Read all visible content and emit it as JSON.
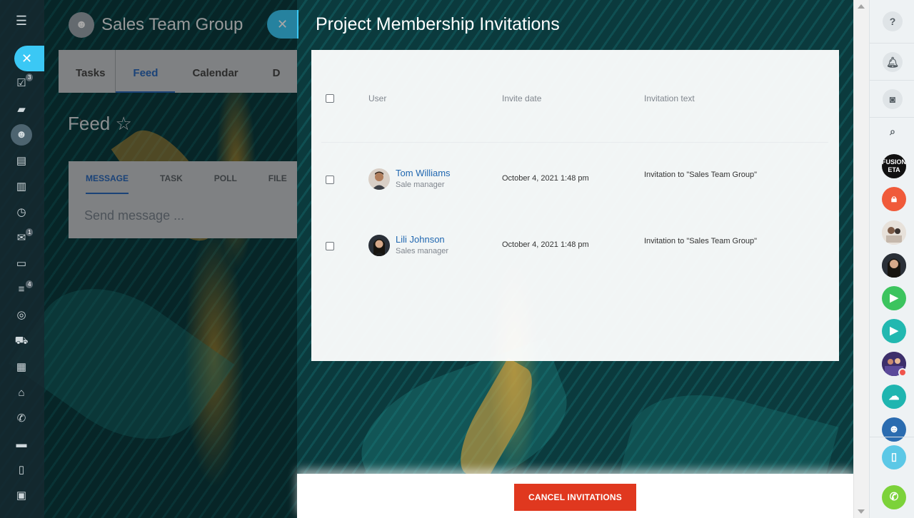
{
  "left_rail": {
    "badges": {
      "tasks": "3",
      "mail": "1",
      "crm": "4"
    }
  },
  "underlying": {
    "group_title": "Sales Team Group",
    "tabs": [
      "Tasks",
      "Feed",
      "Calendar",
      "D"
    ],
    "active_tab": "Feed",
    "feed_title": "Feed",
    "composer_tabs": [
      "MESSAGE",
      "TASK",
      "POLL",
      "FILE"
    ],
    "composer_placeholder": "Send message ..."
  },
  "panel": {
    "title": "Project Membership Invitations",
    "columns": {
      "user": "User",
      "date": "Invite date",
      "text": "Invitation text"
    },
    "rows": [
      {
        "name": "Tom Williams",
        "position": "Sale manager",
        "date": "October 4, 2021 1:48 pm",
        "text": "Invitation to \"Sales Team Group\""
      },
      {
        "name": "Lili Johnson",
        "position": "Sales manager",
        "date": "October 4, 2021 1:48 pm",
        "text": "Invitation to \"Sales Team Group\""
      }
    ],
    "cancel_label": "CANCEL INVITATIONS"
  },
  "right_bar": {
    "help_label": "?",
    "fusion_label": "FUSION\nETA"
  },
  "colors": {
    "accent_blue": "#2067b0",
    "cancel_red": "#e0381f",
    "close_cyan": "#3bc8f5"
  }
}
